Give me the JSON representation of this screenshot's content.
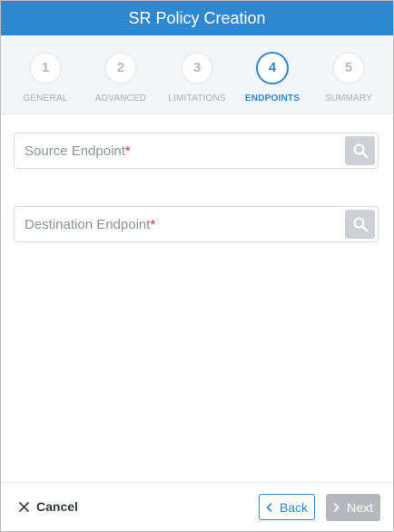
{
  "dialog": {
    "title": "SR Policy Creation"
  },
  "steps": [
    {
      "number": "1",
      "label": "GENERAL",
      "state": "inactive"
    },
    {
      "number": "2",
      "label": "ADVANCED",
      "state": "inactive"
    },
    {
      "number": "3",
      "label": "LIMITATIONS",
      "state": "inactive"
    },
    {
      "number": "4",
      "label": "ENDPOINTS",
      "state": "active"
    },
    {
      "number": "5",
      "label": "SUMMARY",
      "state": "inactive"
    }
  ],
  "fields": {
    "source": {
      "label": "Source Endpoint",
      "required_mark": "*",
      "button_icon": "search-icon"
    },
    "destination": {
      "label": "Destination Endpoint",
      "required_mark": "*",
      "button_icon": "search-icon"
    }
  },
  "footer": {
    "cancel_label": "Cancel",
    "cancel_icon": "close-icon",
    "back_label": "Back",
    "back_icon": "chevron-left-icon",
    "next_label": "Next",
    "next_icon": "chevron-right-icon"
  },
  "colors": {
    "accent": "#2f87cd",
    "required": "#d9342b",
    "disabled_button": "#b5b9bd"
  }
}
